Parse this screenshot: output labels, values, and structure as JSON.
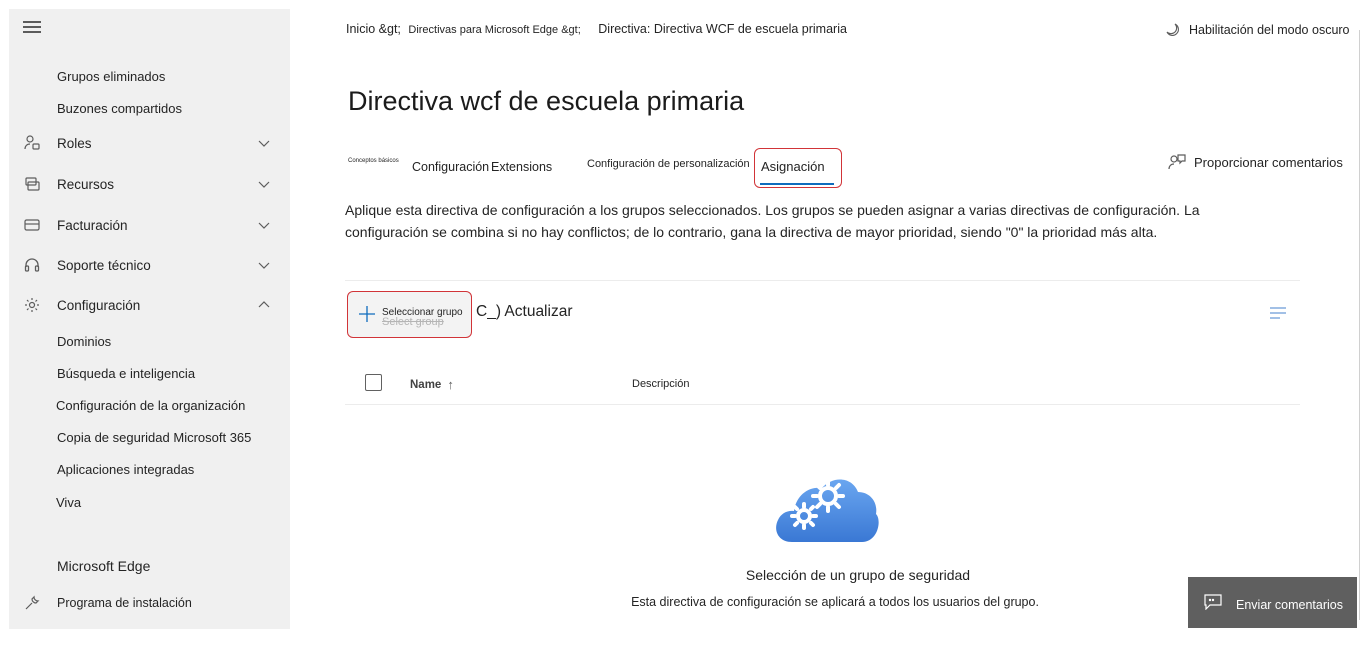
{
  "sidebar": {
    "top_items": [
      "Grupos eliminados",
      "Buzones compartidos"
    ],
    "nav_items": [
      {
        "label": "Roles",
        "icon": "roles-icon",
        "expanded": false
      },
      {
        "label": "Recursos",
        "icon": "resources-icon",
        "expanded": false
      },
      {
        "label": "Facturación",
        "icon": "billing-icon",
        "expanded": false
      },
      {
        "label": "Soporte técnico",
        "icon": "headset-icon",
        "expanded": false
      },
      {
        "label": "Configuración",
        "icon": "gear-icon",
        "expanded": true
      }
    ],
    "config_sub_items": [
      "Dominios",
      "Búsqueda e inteligencia",
      "Configuración de la organización",
      "Copia de seguridad Microsoft 365",
      "Aplicaciones integradas",
      "Viva"
    ],
    "edge_item": "Microsoft Edge",
    "setup_item": "Programa de instalación"
  },
  "breadcrumb": {
    "home": "Inicio &gt;",
    "edge_policies": "Directivas para Microsoft Edge &gt;",
    "current": "Directiva: Directiva WCF de escuela primaria"
  },
  "dark_mode_label": "Habilitación del modo oscuro",
  "page_title": "Directiva wcf de escuela primaria",
  "tabs": {
    "basics": "Conceptos básicos",
    "settings": "Configuración",
    "extensions": "Extensions",
    "customization": "Configuración de personalización",
    "assignment": "Asignación"
  },
  "feedback_link": "Proporcionar comentarios",
  "description": "Aplique esta directiva de configuración a los grupos seleccionados. Los grupos se pueden asignar a varias directivas de configuración. La configuración se combina si no hay conflictos; de lo contrario, gana la directiva de mayor prioridad, siendo \"0\" la prioridad más alta.",
  "toolbar": {
    "select_group": "Seleccionar grupo",
    "select_group_ghost": "Select group",
    "refresh": "C_) Actualizar"
  },
  "table": {
    "col_name": "Name",
    "col_desc": "Descripción",
    "sort_arrow": "↑"
  },
  "empty_state": {
    "title": "Selección de un grupo de seguridad",
    "subtitle": "Esta directiva de configuración se aplicará a todos los usuarios del grupo."
  },
  "send_feedback": "Enviar comentarios",
  "colors": {
    "accent": "#0f6cbd",
    "highlight": "#d13438",
    "sidebar_bg": "#f0f0f0",
    "feedback_bg": "#5f5f5f"
  }
}
